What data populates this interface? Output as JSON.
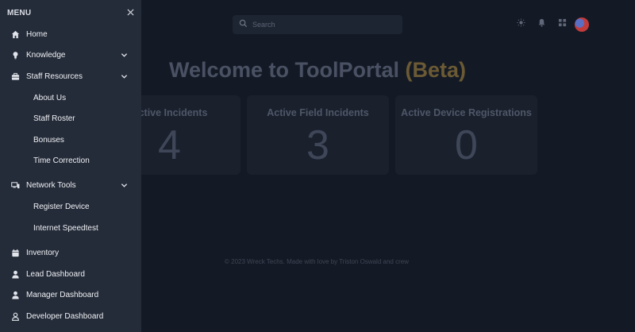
{
  "search": {
    "placeholder": "Search"
  },
  "welcome": {
    "prefix": "Welcome to ToolPortal",
    "beta": "(Beta)"
  },
  "cards": [
    {
      "title": "Active Incidents",
      "value": "4"
    },
    {
      "title": "Active Field Incidents",
      "value": "3"
    },
    {
      "title": "Active Device Registrations",
      "value": "0"
    }
  ],
  "footer": {
    "text": "© 2023 Wreck Techs. Made with love by Triston Oswald and crew"
  },
  "sidebar": {
    "title": "MENU",
    "items": [
      {
        "label": "Home",
        "icon": "home-icon"
      },
      {
        "label": "Knowledge",
        "icon": "bulb-icon"
      },
      {
        "label": "Staff Resources",
        "icon": "briefcase-icon"
      },
      {
        "label": "Network Tools",
        "icon": "devices-icon"
      },
      {
        "label": "Inventory",
        "icon": "calendar-icon"
      },
      {
        "label": "Lead Dashboard",
        "icon": "user-icon"
      },
      {
        "label": "Manager Dashboard",
        "icon": "user-icon"
      },
      {
        "label": "Developer Dashboard",
        "icon": "user-outline-icon"
      }
    ],
    "staff_sub": [
      "About Us",
      "Staff Roster",
      "Bonuses",
      "Time Correction"
    ],
    "network_sub": [
      "Register Device",
      "Internet Speedtest"
    ]
  },
  "colors": {
    "sidebar_bg": "#252c39",
    "page_bg": "#141a25",
    "beta": "#6b5a34"
  }
}
